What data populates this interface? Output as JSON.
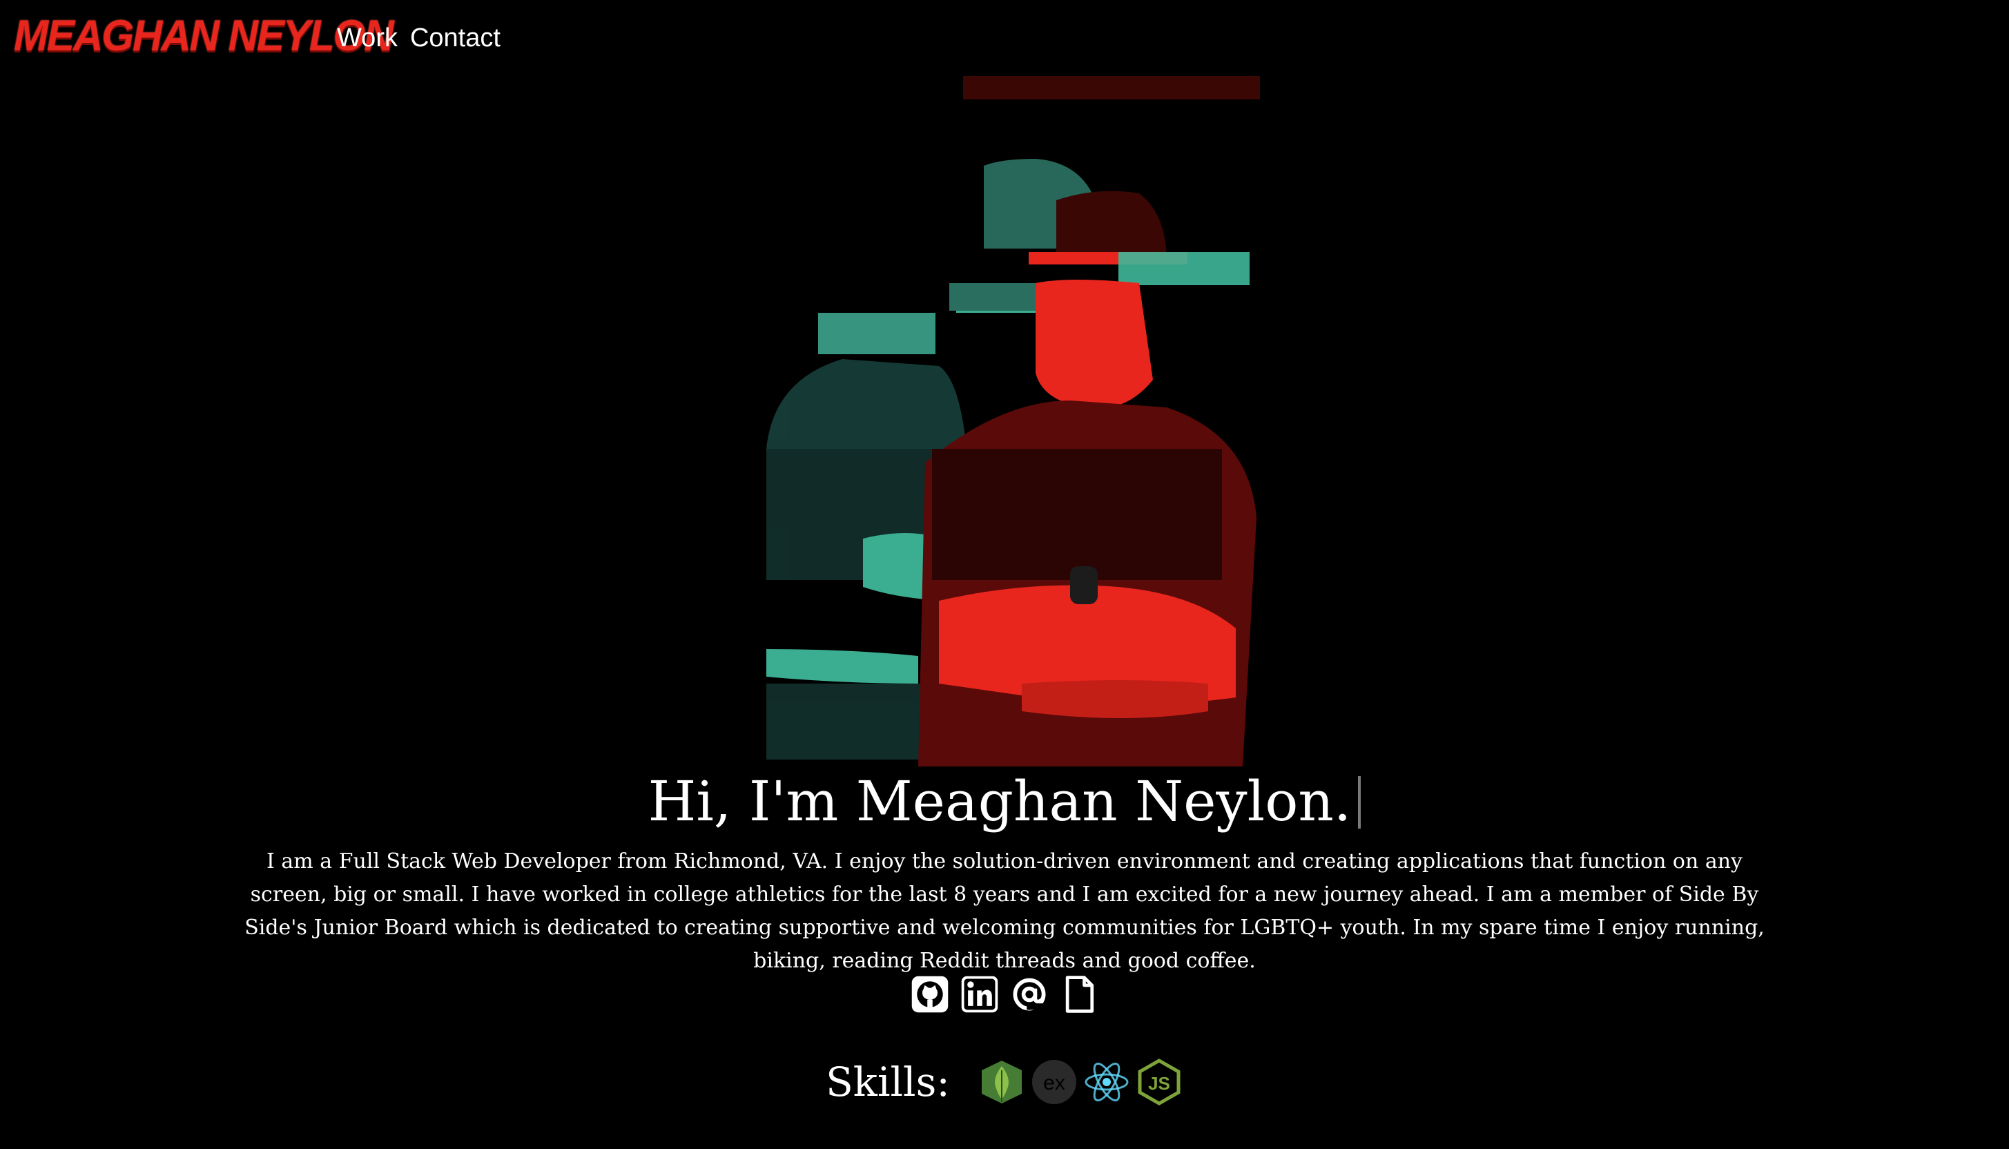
{
  "nav": {
    "logo_text": "MEAGHAN NEYLON",
    "links": [
      "Work",
      "Contact"
    ]
  },
  "hero": {
    "headline": "Hi, I'm Meaghan Neylon.",
    "bio": "I am a Full Stack Web Developer from Richmond, VA. I enjoy the solution-driven environment and creating applications that function on any screen, big or small. I have worked in college athletics for the last 8 years and I am excited for a new journey ahead. I am a member of Side By Side's Junior Board which is dedicated to creating supportive and welcoming communities for LGBTQ+ youth. In my spare time I enjoy running, biking, reading Reddit threads and good coffee."
  },
  "social": [
    {
      "icon": "github-icon"
    },
    {
      "icon": "linkedin-icon"
    },
    {
      "icon": "email-icon"
    },
    {
      "icon": "document-icon"
    }
  ],
  "skills": {
    "label": "Skills:",
    "items": [
      {
        "icon": "mongodb-icon",
        "text": ""
      },
      {
        "icon": "express-icon",
        "text": "ex"
      },
      {
        "icon": "react-icon",
        "text": ""
      },
      {
        "icon": "nodejs-icon",
        "text": "JS"
      }
    ]
  },
  "colors": {
    "background": "#000000",
    "text": "#ffffff",
    "accent_red": "#e8261d",
    "teal": "#3fb89a",
    "mongodb_green": "#4e8a3a",
    "react_blue": "#61dafb",
    "node_green": "#7ea33a"
  }
}
